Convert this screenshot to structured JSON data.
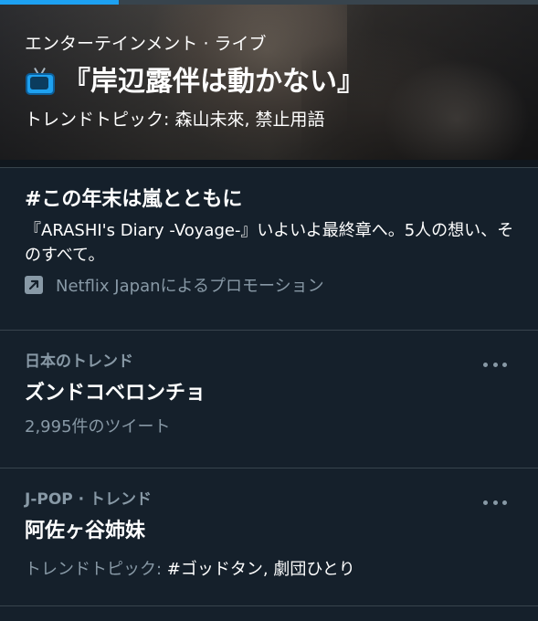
{
  "progress": {
    "fraction": 0.22,
    "accent": "#1da1f2"
  },
  "hero": {
    "category": "エンターテインメント · ライブ",
    "icon": "tv-icon",
    "title": "『岸辺露伴は動かない』",
    "topics": "トレンドトピック: 森山未來, 禁止用語"
  },
  "promo": {
    "title": "#この年末は嵐とともに",
    "description": "『ARASHI's Diary -Voyage-』いよいよ最終章へ。5人の想い、そのすべて。",
    "promoted_icon": "promoted-arrow-icon",
    "promoted_by": "Netflix Japanによるプロモーション"
  },
  "trends": [
    {
      "meta": "日本のトレンド",
      "name": "ズンドコベロンチョ",
      "count": "2,995件のツイート"
    },
    {
      "meta": "J-POP · トレンド",
      "name": "阿佐ヶ谷姉妹",
      "topics_label": "トレンドトピック: ",
      "topics_value": "#ゴッドタン, 劇団ひとり"
    }
  ],
  "colors": {
    "background": "#15202b",
    "secondary_text": "#8899a6",
    "divider": "#38444d"
  }
}
